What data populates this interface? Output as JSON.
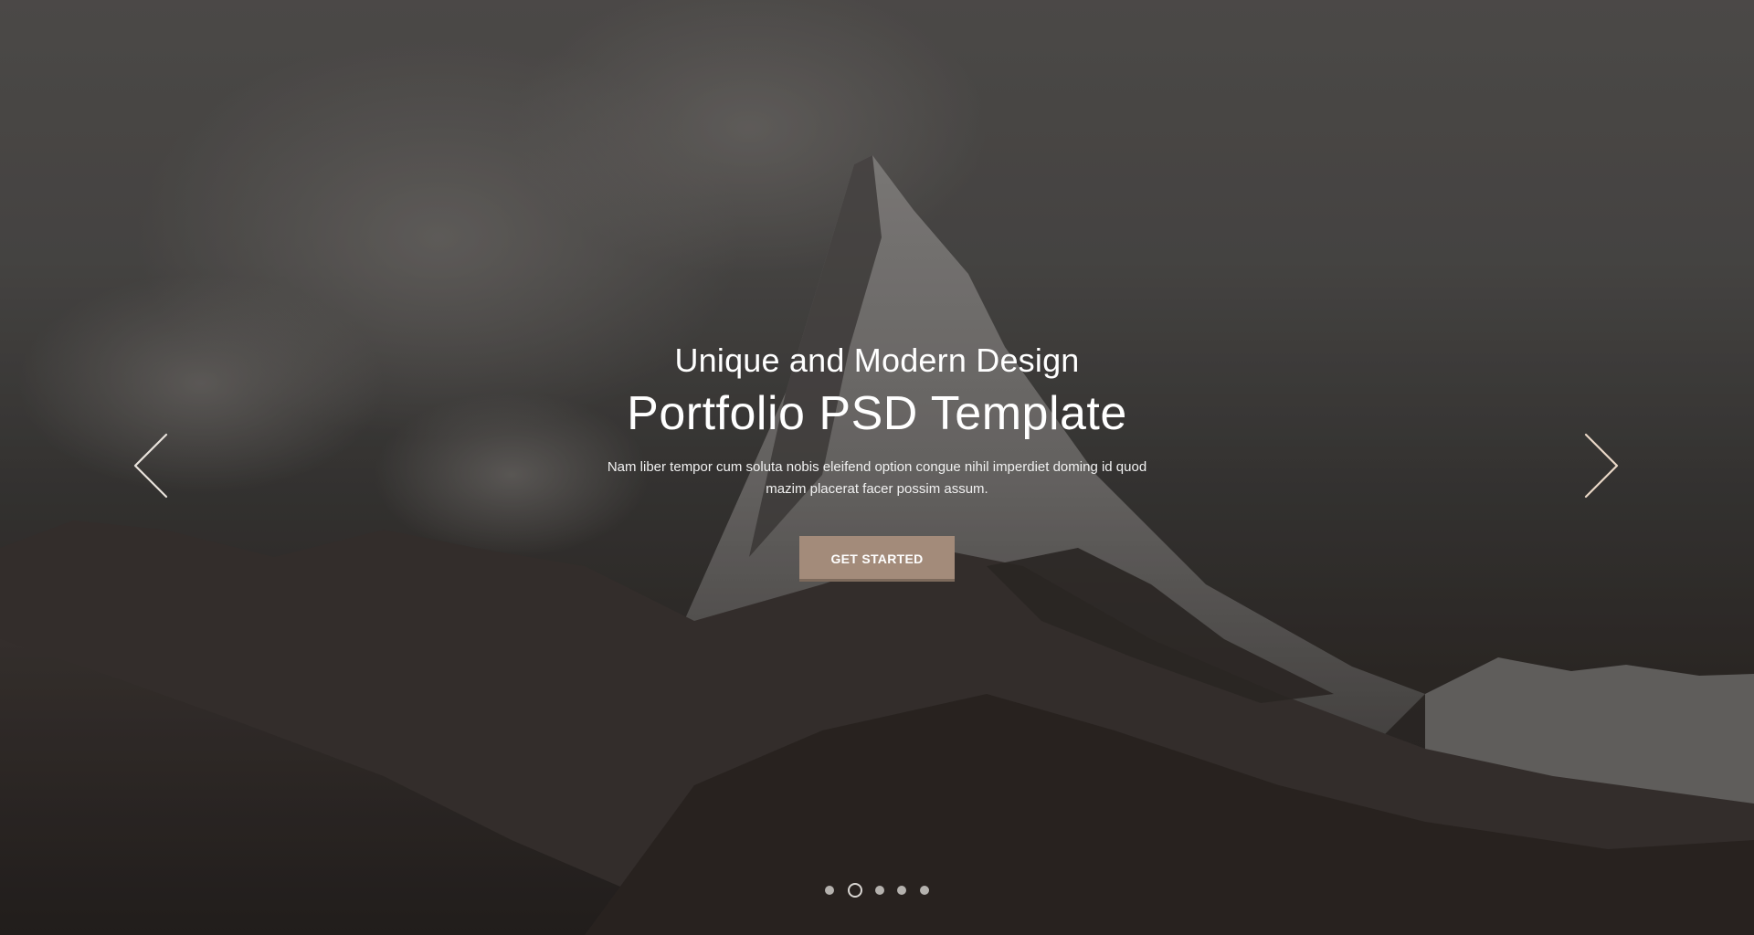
{
  "hero": {
    "subtitle": "Unique and Modern Design",
    "title": "Portfolio PSD Template",
    "description": "Nam liber tempor cum soluta nobis eleifend option congue nihil imperdiet doming id quod mazim placerat facer possim assum.",
    "cta_label": "GET STARTED"
  },
  "carousel": {
    "prev_icon": "chevron-left-icon",
    "next_icon": "chevron-right-icon",
    "slide_count": 5,
    "active_index": 1
  },
  "colors": {
    "accent": "#a38b7a",
    "text": "#ffffff"
  }
}
